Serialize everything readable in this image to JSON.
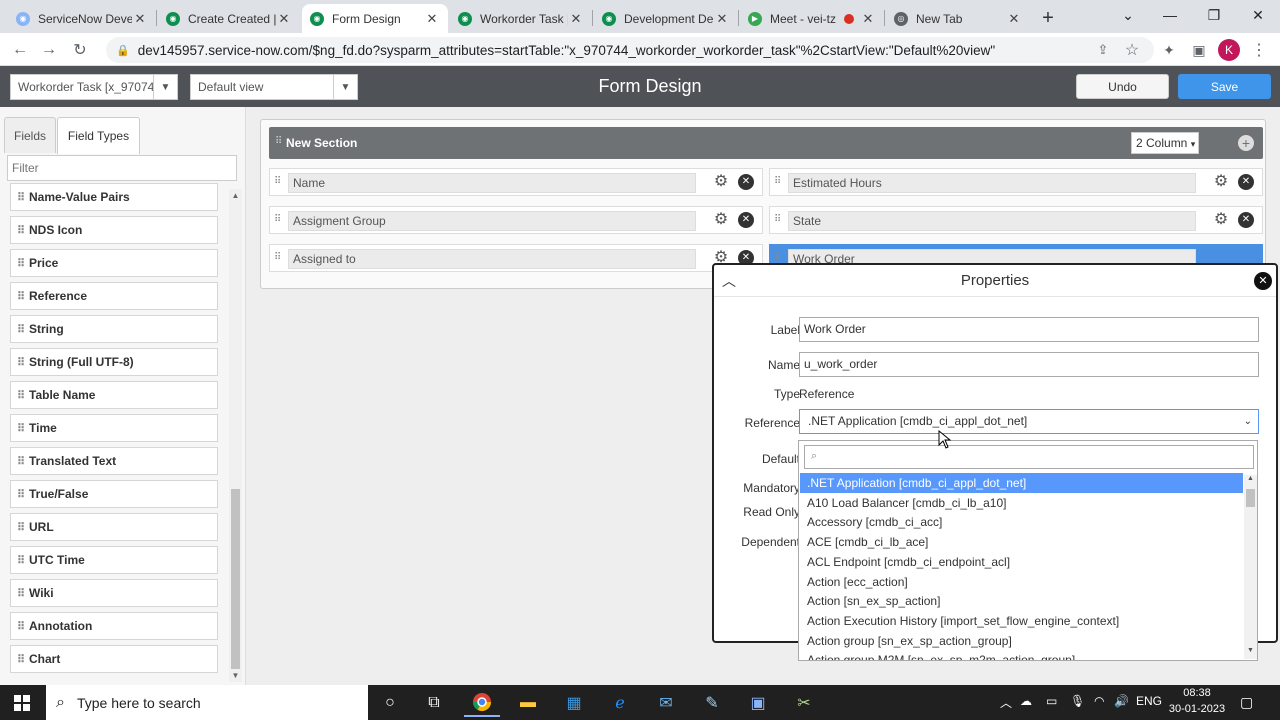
{
  "browser": {
    "tabs": [
      {
        "title": "ServiceNow Deve",
        "active": false
      },
      {
        "title": "Create Created |",
        "active": false
      },
      {
        "title": "Form Design",
        "active": true
      },
      {
        "title": "Workorder Task |",
        "active": false
      },
      {
        "title": "Development De",
        "active": false
      },
      {
        "title": "Meet - vei-tz",
        "active": false
      },
      {
        "title": "New Tab",
        "active": false
      }
    ],
    "url": "dev145957.service-now.com/$ng_fd.do?sysparm_attributes=startTable:\"x_970744_workorder_workorder_task\"%2CstartView:\"Default%20view\"",
    "profile_initial": "K"
  },
  "header": {
    "table_select": "Workorder Task [x_970744",
    "view_select": "Default view",
    "title": "Form Design",
    "undo_label": "Undo",
    "save_label": "Save"
  },
  "left_panel": {
    "tabs": [
      "Fields",
      "Field Types"
    ],
    "filter_placeholder": "Filter",
    "items": [
      "Name-Value Pairs",
      "NDS Icon",
      "Price",
      "Reference",
      "String",
      "String (Full UTF-8)",
      "Table Name",
      "Time",
      "Translated Text",
      "True/False",
      "URL",
      "UTC Time",
      "Wiki",
      "Annotation",
      "Chart"
    ]
  },
  "section": {
    "title": "New Section",
    "columns_select": "2 Column",
    "left_fields": [
      "Name",
      "Assigment Group",
      "Assigned to"
    ],
    "right_fields": [
      "Estimated Hours",
      "State",
      "Work Order"
    ]
  },
  "properties": {
    "title": "Properties",
    "label_caption": "Label",
    "label_value": "Work Order",
    "name_caption": "Name",
    "name_value": "u_work_order",
    "type_caption": "Type",
    "type_value": "Reference",
    "reference_caption": "Reference",
    "reference_value": ".NET Application [cmdb_ci_appl_dot_net]",
    "default_caption": "Default",
    "mandatory_caption": "Mandatory",
    "readonly_caption": "Read Only",
    "dependent_caption": "Dependent"
  },
  "dropdown": {
    "options": [
      ".NET Application [cmdb_ci_appl_dot_net]",
      "A10 Load Balancer [cmdb_ci_lb_a10]",
      "Accessory [cmdb_ci_acc]",
      "ACE [cmdb_ci_lb_ace]",
      "ACL Endpoint [cmdb_ci_endpoint_acl]",
      "Action [ecc_action]",
      "Action [sn_ex_sp_action]",
      "Action Execution History [import_set_flow_engine_context]",
      "Action group [sn_ex_sp_action_group]",
      "Action group M2M [sn_ex_sp_m2m_action_group]"
    ]
  },
  "taskbar": {
    "search_placeholder": "Type here to search",
    "lang": "ENG",
    "time": "08:38",
    "date": "30-01-2023"
  },
  "colors": {
    "accent": "#4a90e2",
    "save": "#3f95ea",
    "selected_option": "#5897fb",
    "header_bg": "#4f5256"
  }
}
